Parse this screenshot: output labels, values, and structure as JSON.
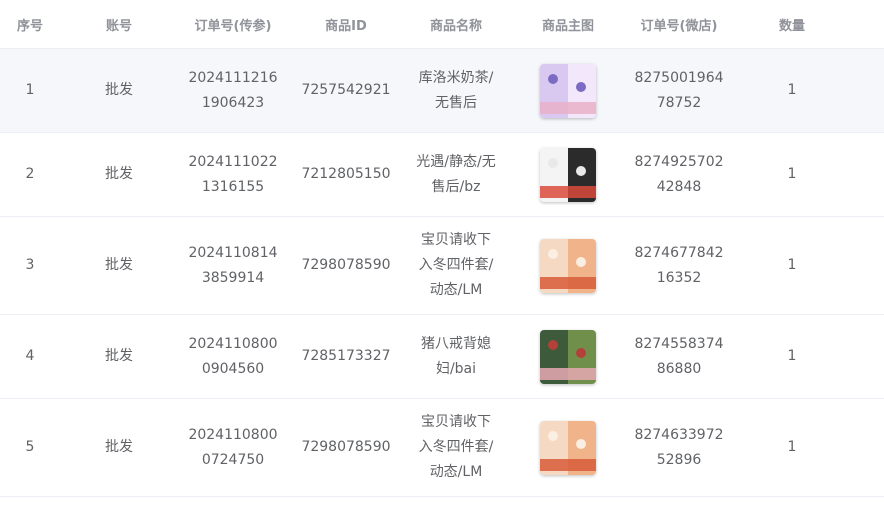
{
  "columns": [
    "序号",
    "账号",
    "订单号(传参)",
    "商品ID",
    "商品名称",
    "商品主图",
    "订单号(微店)",
    "数量"
  ],
  "rows": [
    {
      "index": "1",
      "account": "批发",
      "order_chuancan": [
        "2024111216",
        "1906423"
      ],
      "product_id": "7257542921",
      "product_name": [
        "库洛米奶茶/",
        "无售后"
      ],
      "image": {
        "theme": "purple-sticker-pack",
        "colors": [
          "#d9c9f1",
          "#f3e7fb",
          "#e8b0c8",
          "#7b6bc2"
        ]
      },
      "order_weidian": [
        "8275001964",
        "78752"
      ],
      "quantity": "1"
    },
    {
      "index": "2",
      "account": "批发",
      "order_chuancan": [
        "2024111022",
        "1316155"
      ],
      "product_id": "7212805150",
      "product_name": [
        "光遇/静态/无",
        "售后/bz"
      ],
      "image": {
        "theme": "bw-sticker-pack",
        "colors": [
          "#f4f4f4",
          "#2b2b2b",
          "#d84a3a",
          "#e9e9e9"
        ]
      },
      "order_weidian": [
        "8274925702",
        "42848"
      ],
      "quantity": "1"
    },
    {
      "index": "3",
      "account": "批发",
      "order_chuancan": [
        "2024110814",
        "3859914"
      ],
      "product_id": "7298078590",
      "product_name": [
        "宝贝请收下",
        "入冬四件套/",
        "动态/LM"
      ],
      "image": {
        "theme": "orange-sticker-pack",
        "colors": [
          "#f6d9c2",
          "#f1b48a",
          "#d85c3a",
          "#fbeee3"
        ]
      },
      "order_weidian": [
        "8274677842",
        "16352"
      ],
      "quantity": "1"
    },
    {
      "index": "4",
      "account": "批发",
      "order_chuancan": [
        "2024110800",
        "0904560"
      ],
      "product_id": "7285173327",
      "product_name": [
        "猪八戒背媳",
        "妇/bai"
      ],
      "image": {
        "theme": "green-sticker-pack",
        "colors": [
          "#3d5a3a",
          "#6f8f4a",
          "#e7a9b4",
          "#b3413a"
        ]
      },
      "order_weidian": [
        "8274558374",
        "86880"
      ],
      "quantity": "1"
    },
    {
      "index": "5",
      "account": "批发",
      "order_chuancan": [
        "2024110800",
        "0724750"
      ],
      "product_id": "7298078590",
      "product_name": [
        "宝贝请收下",
        "入冬四件套/",
        "动态/LM"
      ],
      "image": {
        "theme": "orange-sticker-pack",
        "colors": [
          "#f6d9c2",
          "#f1b48a",
          "#d85c3a",
          "#fbeee3"
        ]
      },
      "order_weidian": [
        "8274633972",
        "52896"
      ],
      "quantity": "1"
    }
  ],
  "colors": {
    "header_text": "#909399",
    "body_text": "#606266",
    "row_border": "#ebeef5",
    "hover_row_bg": "#f5f7fa"
  },
  "highlighted_row": 0
}
